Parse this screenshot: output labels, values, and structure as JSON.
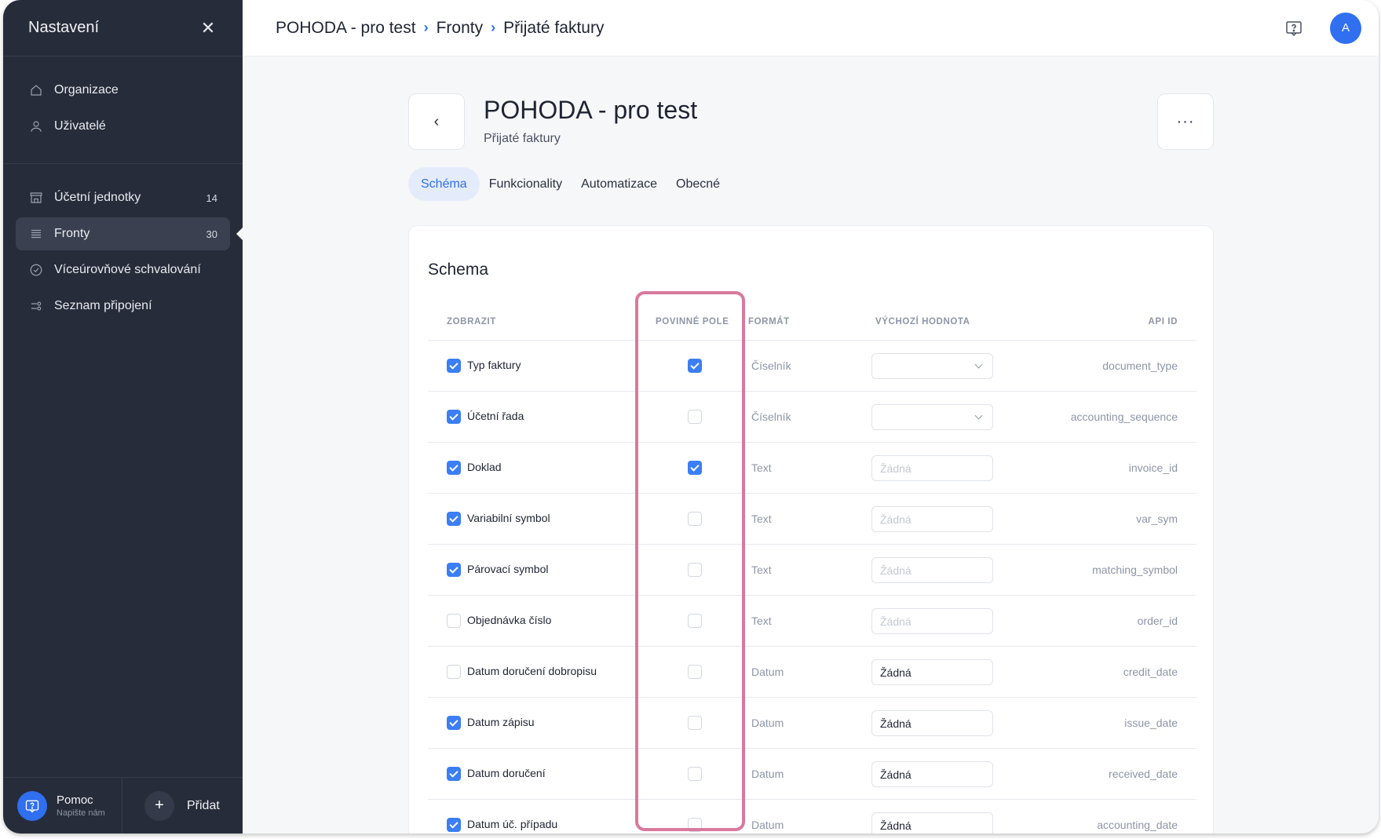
{
  "sidebar": {
    "title": "Nastavení",
    "close_icon": "close-icon",
    "group1": [
      {
        "label": "Organizace",
        "icon": "home-icon"
      },
      {
        "label": "Uživatelé",
        "icon": "user-icon"
      }
    ],
    "group2": [
      {
        "label": "Účetní jednotky",
        "count": "14",
        "icon": "store-icon"
      },
      {
        "label": "Fronty",
        "count": "30",
        "icon": "list-icon",
        "active": true
      },
      {
        "label": "Víceúrovňové schvalování",
        "icon": "check-circle-icon"
      },
      {
        "label": "Seznam připojení",
        "icon": "connections-icon"
      }
    ],
    "help_title": "Pomoc",
    "help_sub": "Napište nám",
    "add_label": "Přidat"
  },
  "breadcrumb": [
    "POHODA - pro test",
    "Fronty",
    "Přijaté faktury"
  ],
  "header": {
    "title": "POHODA - pro test",
    "subtitle": "Přijaté faktury",
    "back": "‹",
    "more": "···"
  },
  "avatar": "A",
  "tabs": [
    "Schéma",
    "Funkcionality",
    "Automatizace",
    "Obecné"
  ],
  "schema": {
    "title": "Schema",
    "columns": [
      "ZOBRAZIT",
      "POVINNÉ POLE",
      "FORMÁT",
      "VÝCHOZÍ HODNOTA",
      "API ID"
    ],
    "rows": [
      {
        "label": "Typ faktury",
        "show": true,
        "required": true,
        "format": "Číselník",
        "default": "",
        "default_kind": "select",
        "api": "document_type"
      },
      {
        "label": "Účetní řada",
        "show": true,
        "required": false,
        "format": "Číselník",
        "default": "",
        "default_kind": "select",
        "api": "accounting_sequence"
      },
      {
        "label": "Doklad",
        "show": true,
        "required": true,
        "format": "Text",
        "default": "Žádná",
        "default_kind": "placeholder",
        "api": "invoice_id"
      },
      {
        "label": "Variabilní symbol",
        "show": true,
        "required": false,
        "format": "Text",
        "default": "Žádná",
        "default_kind": "placeholder",
        "api": "var_sym"
      },
      {
        "label": "Párovací symbol",
        "show": true,
        "required": false,
        "format": "Text",
        "default": "Žádná",
        "default_kind": "placeholder",
        "api": "matching_symbol"
      },
      {
        "label": "Objednávka číslo",
        "show": false,
        "required": false,
        "format": "Text",
        "default": "Žádná",
        "default_kind": "placeholder",
        "api": "order_id"
      },
      {
        "label": "Datum doručení dobropisu",
        "show": false,
        "required": false,
        "format": "Datum",
        "default": "Žádná",
        "default_kind": "value",
        "api": "credit_date"
      },
      {
        "label": "Datum zápisu",
        "show": true,
        "required": false,
        "format": "Datum",
        "default": "Žádná",
        "default_kind": "value",
        "api": "issue_date"
      },
      {
        "label": "Datum doručení",
        "show": true,
        "required": false,
        "format": "Datum",
        "default": "Žádná",
        "default_kind": "value",
        "api": "received_date"
      },
      {
        "label": "Datum úč. případu",
        "show": true,
        "required": false,
        "format": "Datum",
        "default": "Žádná",
        "default_kind": "value",
        "api": "accounting_date"
      }
    ]
  },
  "colors": {
    "accent": "#2f6ff0",
    "sidebar": "#272c3a",
    "highlight": "#d9799c"
  }
}
